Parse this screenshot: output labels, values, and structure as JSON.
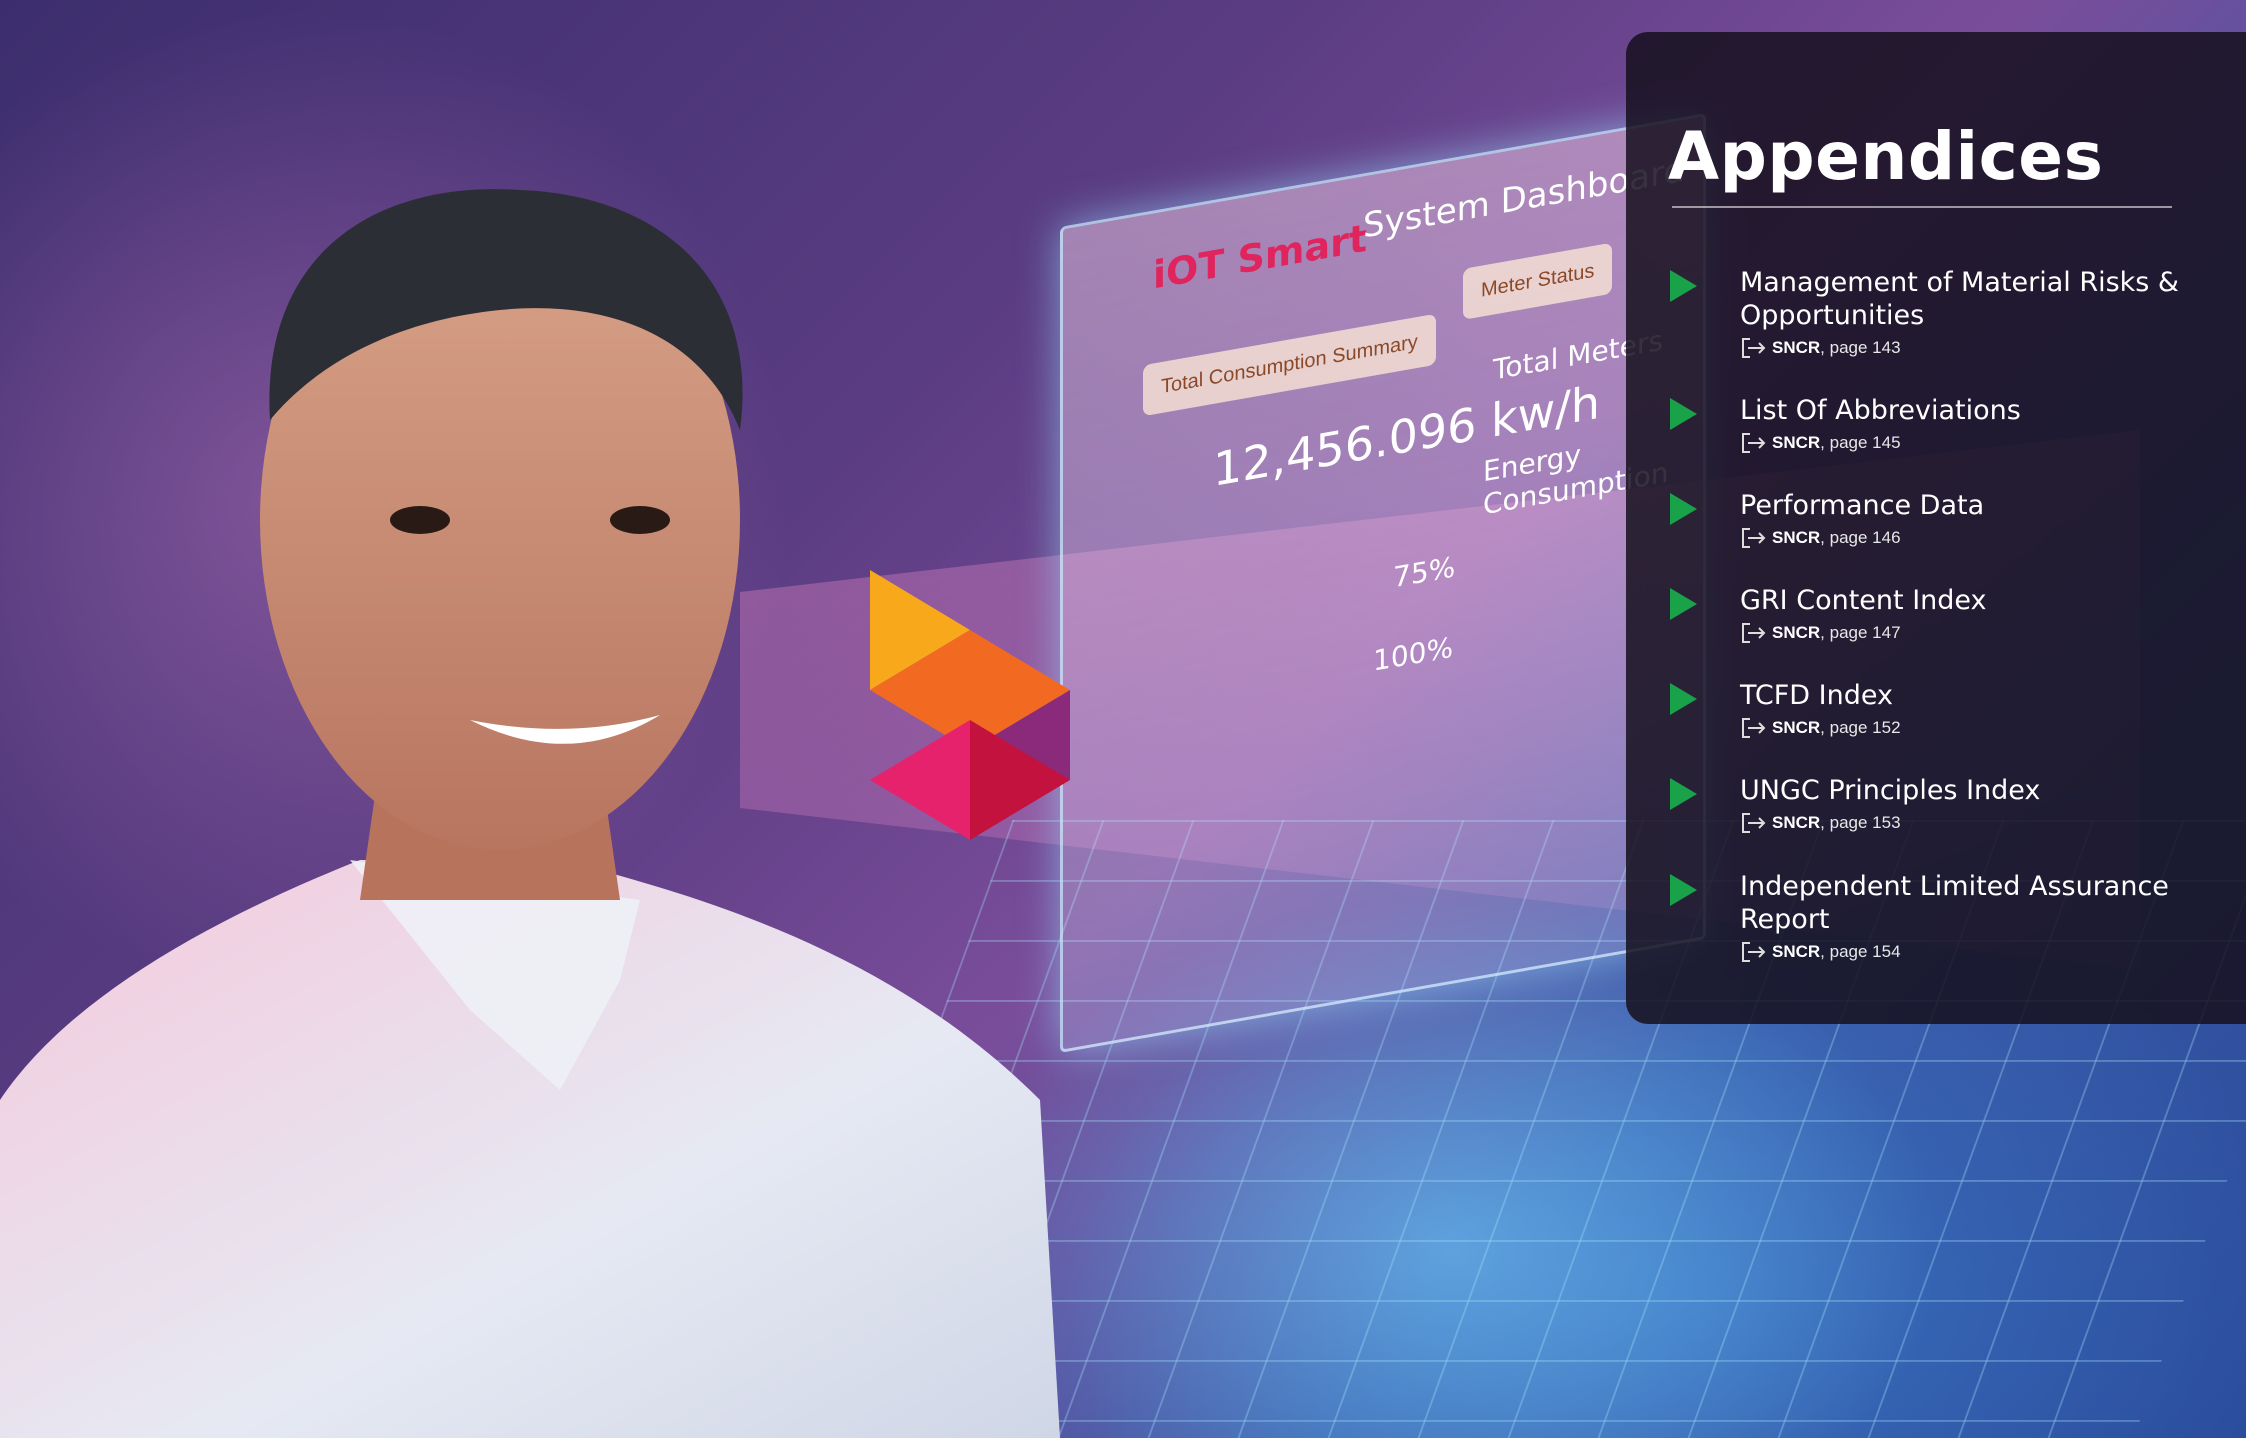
{
  "panel": {
    "heading": "Appendices",
    "items": [
      {
        "title": "Management of Material Risks & Opportunities",
        "ref_label": "SNCR",
        "page_text": ", page 143"
      },
      {
        "title": "List Of Abbreviations",
        "ref_label": "SNCR",
        "page_text": ", page 145"
      },
      {
        "title": "Performance Data",
        "ref_label": "SNCR",
        "page_text": ", page 146"
      },
      {
        "title": "GRI Content Index",
        "ref_label": "SNCR",
        "page_text": ", page 147"
      },
      {
        "title": "TCFD Index",
        "ref_label": "SNCR",
        "page_text": ", page 152"
      },
      {
        "title": "UNGC Principles Index",
        "ref_label": "SNCR",
        "page_text": ", page 153"
      },
      {
        "title": "Independent Limited Assurance Report",
        "ref_label": "SNCR",
        "page_text": ", page 154"
      }
    ]
  },
  "hologram": {
    "logo": "iOT Smart",
    "title": "System Dashboard",
    "card_summary": "Total Consumption Summary",
    "card_status": "Meter Status",
    "reading": "12,456.096 kw/h",
    "total_meters": "Total Meters",
    "energy": "Energy Consumption",
    "pct_75": "75%",
    "pct_100": "100%"
  },
  "colors": {
    "accent_green": "#19a24a",
    "panel_bg": "#16101e"
  }
}
